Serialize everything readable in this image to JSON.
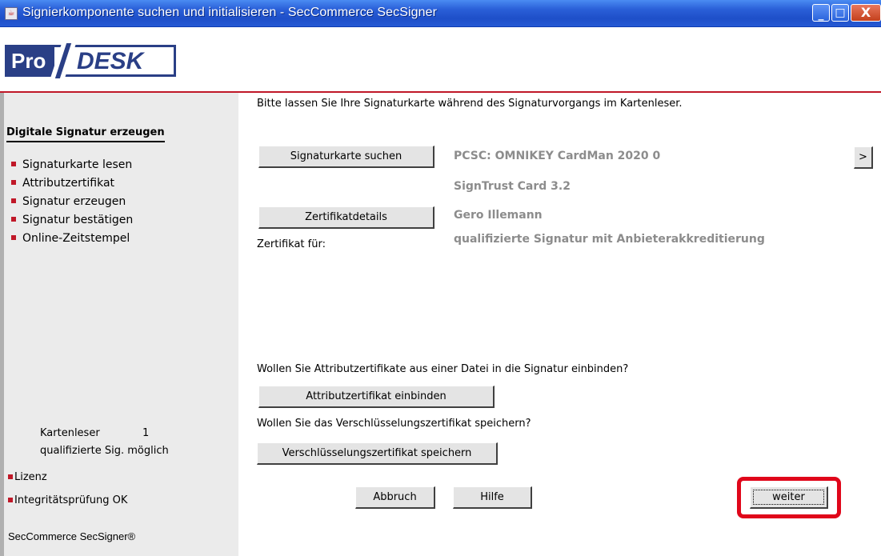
{
  "window": {
    "title": "Signierkomponente suchen und initialisieren  - SecCommerce SecSigner",
    "min_glyph": "_",
    "max_glyph": "□",
    "close_glyph": "X"
  },
  "logo": {
    "pro": "Pro",
    "desk": "DESK"
  },
  "sidebar": {
    "title": "Digitale Signatur erzeugen",
    "items": [
      {
        "label": "Signaturkarte lesen"
      },
      {
        "label": "Attributzertifikat"
      },
      {
        "label": "Signatur erzeugen"
      },
      {
        "label": "Signatur bestätigen"
      },
      {
        "label": "Online-Zeitstempel"
      }
    ],
    "reader_label": "Kartenleser",
    "reader_count": "1",
    "qualified_possible": "qualifizierte Sig. möglich",
    "lizenz": "Lizenz",
    "integritaet": "Integritätsprüfung OK",
    "footer": "SecCommerce SecSigner®"
  },
  "main": {
    "instruction": "Bitte lassen Sie Ihre Signaturkarte während des Signaturvorgangs im Kartenleser.",
    "search_card_button": "Signaturkarte suchen",
    "reader_name": "PCSC: OMNIKEY CardMan 2020 0",
    "next_reader_button": ">",
    "card_type": "SignTrust Card 3.2",
    "cert_details_button": "Zertifikatdetails",
    "holder_name": "Gero Illemann",
    "cert_for_label": "Zertifikat für:",
    "cert_type": "qualifizierte Signatur mit Anbieterakkreditierung",
    "attr_question": "Wollen Sie Attributzertifikate aus einer Datei in die Signatur einbinden?",
    "attr_button": "Attributzertifikat einbinden",
    "enc_question": "Wollen Sie das Verschlüsselungszertifikat speichern?",
    "enc_button": "Verschlüsselungszertifikat speichern",
    "cancel_button": "Abbruch",
    "help_button": "Hilfe",
    "next_button": "weiter"
  },
  "colors": {
    "accent_red": "#c01828",
    "highlight_red": "#e0061a",
    "brand_blue": "#2a3f86",
    "titlebar_blue": "#2a5fd8"
  }
}
